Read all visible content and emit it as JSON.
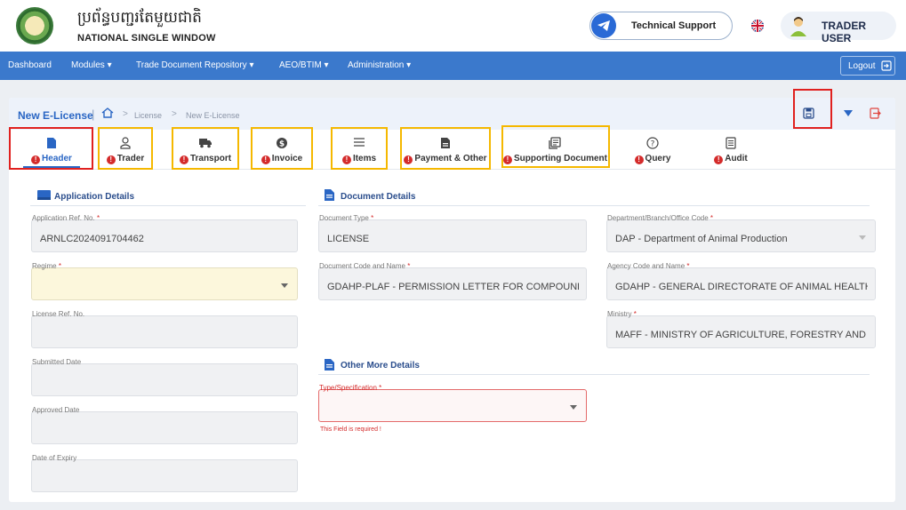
{
  "header": {
    "brand_kh": "ប្រព័ន្ធបញ្ជរតែមួយជាតិ",
    "brand_en": "NATIONAL SINGLE WINDOW",
    "support_label": "Technical Support",
    "user_label": "TRADER USER"
  },
  "nav": {
    "items": [
      "Dashboard",
      "Modules ▾",
      "Trade Document Repository ▾",
      "AEO/BTIM ▾",
      "Administration ▾"
    ],
    "logout_label": "Logout"
  },
  "breadcrumb": {
    "title": "New E-License",
    "separator": "|",
    "links": [
      "License",
      "New E-License"
    ],
    "arrow": ">"
  },
  "tabs": [
    {
      "label": "Header",
      "icon": "file-icon",
      "active": true
    },
    {
      "label": "Trader",
      "icon": "person-icon"
    },
    {
      "label": "Transport",
      "icon": "truck-icon"
    },
    {
      "label": "Invoice",
      "icon": "dollar-icon"
    },
    {
      "label": "Items",
      "icon": "list-icon"
    },
    {
      "label": "Payment & Other",
      "icon": "file-icon"
    },
    {
      "label": "Supporting Document",
      "icon": "documents-icon"
    },
    {
      "label": "Query",
      "icon": "question-icon"
    },
    {
      "label": "Audit",
      "icon": "audit-icon"
    }
  ],
  "error_mark": "!",
  "sections": {
    "application": "Application Details",
    "document": "Document Details",
    "other": "Other More Details"
  },
  "fields": {
    "app_ref": {
      "label": "Application Ref. No.",
      "value": "ARNLC2024091704462",
      "required": "*"
    },
    "regime": {
      "label": "Regime",
      "value": "",
      "required": "*"
    },
    "license_ref": {
      "label": "License Ref. No.",
      "value": ""
    },
    "submitted": {
      "label": "Submitted Date",
      "value": ""
    },
    "approved": {
      "label": "Approved Date",
      "value": ""
    },
    "expiry": {
      "label": "Date of Expiry",
      "value": ""
    },
    "doc_type": {
      "label": "Document Type",
      "value": "LICENSE",
      "required": "*"
    },
    "doc_code": {
      "label": "Document Code and Name",
      "value": "GDAHP-PLAF - PERMISSION LETTER FOR COMPOUND",
      "required": "*"
    },
    "dept": {
      "label": "Department/Branch/Office Code",
      "value": "DAP - Department of Animal Production",
      "required": "*"
    },
    "agency": {
      "label": "Agency Code and Name",
      "value": "GDAHP - GENERAL DIRECTORATE OF ANIMAL HEALTH",
      "required": "*"
    },
    "ministry": {
      "label": "Ministry",
      "value": "MAFF - MINISTRY OF AGRICULTURE, FORESTRY AND",
      "required": "*"
    },
    "type_spec": {
      "label": "Type/Specification",
      "value": "",
      "required": "*",
      "error": "This Field is required !"
    }
  },
  "colors": {
    "primary": "#3b79cc",
    "error": "#d42b2b",
    "highlight_red": "#e0211f",
    "highlight_yellow": "#f5b800"
  }
}
